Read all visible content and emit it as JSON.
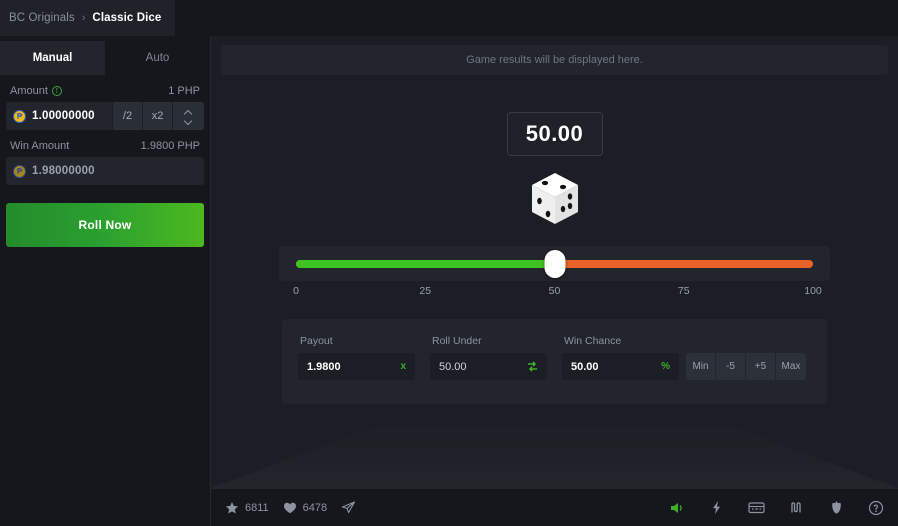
{
  "breadcrumb": {
    "root": "BC Originals",
    "separator": "›",
    "current": "Classic Dice"
  },
  "sidebar": {
    "tabs": [
      {
        "label": "Manual",
        "active": true
      },
      {
        "label": "Auto",
        "active": false
      }
    ],
    "amount": {
      "label": "Amount",
      "info_glyph": "!",
      "right_value": "1 PHP",
      "coin_symbol": "₱",
      "value": "1.00000000",
      "half_label": "/2",
      "double_label": "x2"
    },
    "win_amount": {
      "label": "Win Amount",
      "right_value": "1.9800 PHP",
      "coin_symbol": "₱",
      "value": "1.98000000"
    },
    "roll_button": "Roll Now"
  },
  "game": {
    "results_placeholder": "Game results will be displayed here.",
    "dice_value": "50.00",
    "slider": {
      "value": 50,
      "min": 0,
      "max": 100,
      "ticks": [
        "0",
        "25",
        "50",
        "75",
        "100"
      ],
      "fill_color": "#3ec422",
      "rest_color": "#e8622a",
      "thumb_color": "#ffffff"
    },
    "stats": {
      "payout": {
        "label": "Payout",
        "value": "1.9800",
        "suffix": "x"
      },
      "roll_under": {
        "label": "Roll Under",
        "value": "50.00",
        "suffix": "swap-icon"
      },
      "win_chance": {
        "label": "Win Chance",
        "value": "50.00",
        "suffix": "%",
        "quick_buttons": [
          "Min",
          "-5",
          "+5",
          "Max"
        ]
      }
    }
  },
  "bottom_bar": {
    "stats": [
      {
        "icon": "star-icon",
        "count": "6811"
      },
      {
        "icon": "heart-icon",
        "count": "6478"
      }
    ],
    "share_icon": "send-icon",
    "tools": [
      {
        "icon": "volume-icon",
        "active": true,
        "color": "#3fae2a"
      },
      {
        "icon": "lightning-icon",
        "active": false
      },
      {
        "icon": "keyboard-icon",
        "active": false
      },
      {
        "icon": "chart-wave-icon",
        "active": false
      },
      {
        "icon": "fairness-icon",
        "active": false
      },
      {
        "icon": "help-icon",
        "active": false
      }
    ]
  }
}
